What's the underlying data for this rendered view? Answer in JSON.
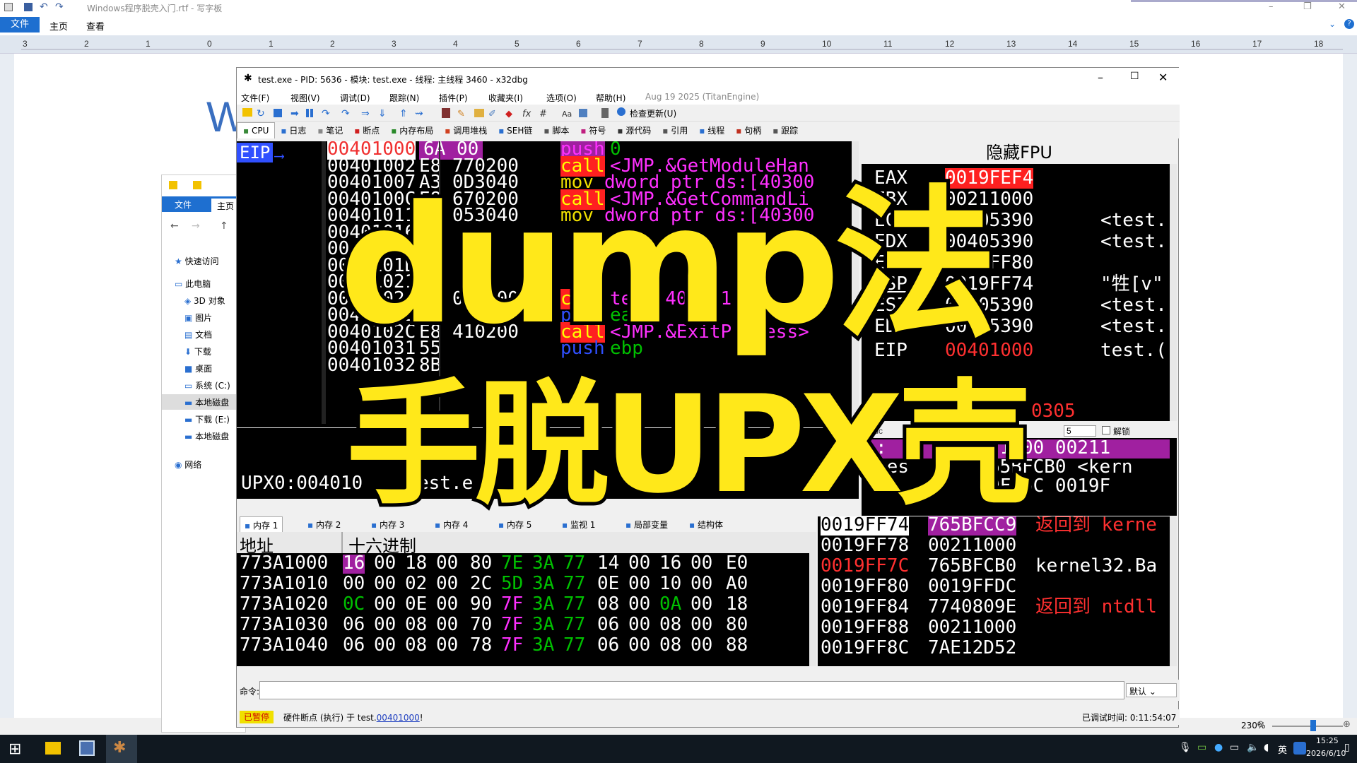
{
  "wordpad": {
    "title": "Windows程序脱壳入门.rtf - 写字板",
    "tabs": [
      "文件",
      "主页",
      "查看"
    ],
    "zoom": "230%",
    "page_initial": "W"
  },
  "explorer": {
    "tabs": [
      "文件",
      "主页"
    ],
    "nav_items": [
      "快速访问",
      "此电脑",
      "3D 对象",
      "图片",
      "文档",
      "下载",
      "桌面",
      "系统 (C:)",
      "本地磁盘",
      "下载 (E:)",
      "本地磁盘",
      "网络"
    ]
  },
  "debugger": {
    "title": "test.exe - PID: 5636 - 模块: test.exe - 线程: 主线程 3460 - x32dbg",
    "menu": [
      "文件(F)",
      "视图(V)",
      "调试(D)",
      "跟踪(N)",
      "插件(P)",
      "收藏夹(I)",
      "选项(O)",
      "帮助(H)",
      "Aug 19 2025 (TitanEngine)"
    ],
    "toolbar_update": "检查更新(U)",
    "tabs": [
      "CPU",
      "日志",
      "笔记",
      "断点",
      "内存布局",
      "调用堆栈",
      "SEH链",
      "脚本",
      "符号",
      "源代码",
      "引用",
      "线程",
      "句柄",
      "跟踪"
    ],
    "eip_label": "EIP",
    "disasm": [
      {
        "addr": "00401000",
        "bytes": "6A 00",
        "mnemonic": "push",
        "operand": "0"
      },
      {
        "addr": "00401002",
        "bytes": "E8 770200",
        "mnemonic": "call",
        "operand": "<JMP.&GetModuleHan"
      },
      {
        "addr": "00401007",
        "bytes": "A3 0D3040",
        "mnemonic": "mov",
        "operand": "dword ptr ds:[40300"
      },
      {
        "addr": "0040100C",
        "bytes": "E8 670200",
        "mnemonic": "call",
        "operand": "<JMP.&GetCommandLi"
      },
      {
        "addr": "00401011",
        "bytes": "A3 053040",
        "mnemonic": "mov",
        "operand": "dword ptr ds:[40300"
      },
      {
        "addr": "00401016",
        "bytes": "6A",
        "mnemonic": "",
        "operand": ""
      },
      {
        "addr": "00401018",
        "bytes": "",
        "mnemonic": "",
        "operand": ""
      },
      {
        "addr": "0040101D",
        "bytes": "",
        "mnemonic": "",
        "operand": ""
      },
      {
        "addr": "00401021",
        "bytes": "",
        "mnemonic": "",
        "operand": ""
      },
      {
        "addr": "00401026",
        "bytes": "E8 060000",
        "mnemonic": "ca",
        "operand": "test.401031"
      },
      {
        "addr": "0040102B",
        "bytes": "50",
        "mnemonic": "push",
        "operand": "eax"
      },
      {
        "addr": "0040102C",
        "bytes": "E8 410200",
        "mnemonic": "call",
        "operand": "<JMP.&ExitProcess>"
      },
      {
        "addr": "00401031",
        "bytes": "55",
        "mnemonic": "push",
        "operand": "ebp"
      },
      {
        "addr": "00401032",
        "bytes": "8B",
        "mnemonic": "",
        "operand": ""
      }
    ],
    "fpu_header": "隐藏FPU",
    "registers": [
      {
        "name": "EAX",
        "value": "0019FEF4",
        "comment": ""
      },
      {
        "name": "EBX",
        "value": "00211000",
        "comment": ""
      },
      {
        "name": "ECX",
        "value": "00405390",
        "comment": "<test."
      },
      {
        "name": "EDX",
        "value": "00405390",
        "comment": "<test."
      },
      {
        "name": "EBP",
        "value": "0019FF80",
        "comment": ""
      },
      {
        "name": "ESP",
        "value": "0019FF74",
        "comment": "\"牲[v\""
      },
      {
        "name": "ESI",
        "value": "00405390",
        "comment": "<test."
      },
      {
        "name": "EDI",
        "value": "00405390",
        "comment": "<test."
      },
      {
        "name": "EIP",
        "value": "00401000",
        "comment": "test.("
      }
    ],
    "eflags_partial": "0305",
    "info_line": "UPX0:004010",
    "info_line2": "est.e",
    "call_conv": "(stdc",
    "arg_count": "5",
    "unlock_label": "解锁",
    "args_rows": [
      {
        "a": ":",
        "b": ".1000 00211"
      },
      {
        "a": "Les",
        "b": "65BFCB0 <kern"
      },
      {
        "a": "[e",
        "b": "9FFDC 0019F"
      }
    ],
    "mem_tabs": [
      "内存 1",
      "内存 2",
      "内存 3",
      "内存 4",
      "内存 5",
      "监视 1",
      "局部变量",
      "结构体"
    ],
    "dump_headers": [
      "地址",
      "十六进制"
    ],
    "dump_rows": [
      {
        "addr": "773A1000",
        "hex": [
          "16",
          "00",
          "18",
          "00",
          "80",
          "7E",
          "3A",
          "77",
          "14",
          "00",
          "16",
          "00",
          "E0"
        ]
      },
      {
        "addr": "773A1010",
        "hex": [
          "00",
          "00",
          "02",
          "00",
          "2C",
          "5D",
          "3A",
          "77",
          "0E",
          "00",
          "10",
          "00",
          "A0"
        ]
      },
      {
        "addr": "773A1020",
        "hex": [
          "0C",
          "00",
          "0E",
          "00",
          "90",
          "7F",
          "3A",
          "77",
          "08",
          "00",
          "0A",
          "00",
          "18"
        ]
      },
      {
        "addr": "773A1030",
        "hex": [
          "06",
          "00",
          "08",
          "00",
          "70",
          "7F",
          "3A",
          "77",
          "06",
          "00",
          "08",
          "00",
          "80"
        ]
      },
      {
        "addr": "773A1040",
        "hex": [
          "06",
          "00",
          "08",
          "00",
          "78",
          "7F",
          "3A",
          "77",
          "06",
          "00",
          "08",
          "00",
          "88"
        ]
      }
    ],
    "stack_rows": [
      {
        "addr": "0019FF74",
        "value": "765BFCC9",
        "comment": "返回到 kerne"
      },
      {
        "addr": "0019FF78",
        "value": "00211000",
        "comment": ""
      },
      {
        "addr": "0019FF7C",
        "value": "765BFCB0",
        "comment": "kernel32.Ba"
      },
      {
        "addr": "0019FF80",
        "value": "0019FFDC",
        "comment": ""
      },
      {
        "addr": "0019FF84",
        "value": "7740809E",
        "comment": "返回到 ntdll"
      },
      {
        "addr": "0019FF88",
        "value": "00211000",
        "comment": ""
      },
      {
        "addr": "0019FF8C",
        "value": "7AE12D52",
        "comment": ""
      }
    ],
    "cmd_label": "命令:",
    "cmd_default": "默认",
    "status_paused": "已暂停",
    "status_message": "硬件断点 (执行) 于 test.",
    "status_link": "00401000",
    "status_message_tail": "!",
    "status_time": "已调试时间: 0:11:54:07"
  },
  "overlay": {
    "line1": "dump法",
    "line2": "手脱UPX壳"
  },
  "taskbar": {
    "time": "15:25",
    "date": "2026/6/10",
    "ime": "英"
  },
  "colors": {
    "overlay_yellow": "#ffe81a",
    "eip_highlight": "#a020a0",
    "call_red": "#ff2020",
    "accent_blue": "#1e6fd0"
  }
}
